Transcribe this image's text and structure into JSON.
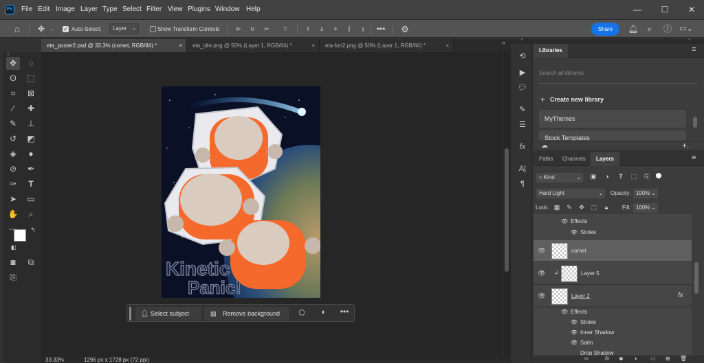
{
  "app": {
    "logo": "Ps"
  },
  "menu": [
    "File",
    "Edit",
    "Image",
    "Layer",
    "Type",
    "Select",
    "Filter",
    "View",
    "Plugins",
    "Window",
    "Help"
  ],
  "options": {
    "auto_select_label": "Auto-Select:",
    "auto_select_checked": true,
    "auto_select_value": "Layer",
    "transform_label": "Show Transform Controls",
    "share_label": "Share"
  },
  "tabs": [
    {
      "label": "eta_poster2.psd @ 33.3% (comet, RGB/8#) *",
      "active": true
    },
    {
      "label": "eta_idle.png @ 50% (Layer 1, RGB/8#) *",
      "active": false
    },
    {
      "label": "eta-fun2.png @ 50% (Layer 1, RGB/8#) *",
      "active": false
    }
  ],
  "canvas": {
    "title_line1": "Kinetic",
    "title_line2": "Panic!"
  },
  "context_bar": {
    "select_subject": "Select subject",
    "remove_background": "Remove background"
  },
  "status": {
    "zoom": "33.33%",
    "doc_size": "1296 px x 1728 px (72 ppi)"
  },
  "libraries": {
    "tab": "Libraries",
    "search_placeholder": "Search all libraries",
    "create_label": "Create new library",
    "items": [
      "MyThemes",
      "Stock Templates"
    ]
  },
  "layers_panel": {
    "tabs": [
      "Paths",
      "Channels",
      "Layers"
    ],
    "active_tab": "Layers",
    "filter_kind": "Kind",
    "blend_mode": "Hard Light",
    "opacity_label": "Opacity:",
    "opacity": "100%",
    "lock_label": "Lock:",
    "fill_label": "Fill:",
    "fill": "100%",
    "top_effects": {
      "effects": "Effects",
      "items": [
        "Stroke"
      ]
    },
    "layers": [
      {
        "name": "comet",
        "selected": true
      },
      {
        "name": "Layer 5",
        "selected": false
      },
      {
        "name": "Layer 2",
        "selected": false
      }
    ],
    "layer2_effects": {
      "effects": "Effects",
      "fx": "fx",
      "items": [
        "Stroke",
        "Inner Shadow",
        "Satin",
        "Drop Shadow"
      ]
    }
  },
  "colors": {
    "accent": "#1473e6",
    "orange": "#f56a2c",
    "space": "#0a1026"
  }
}
